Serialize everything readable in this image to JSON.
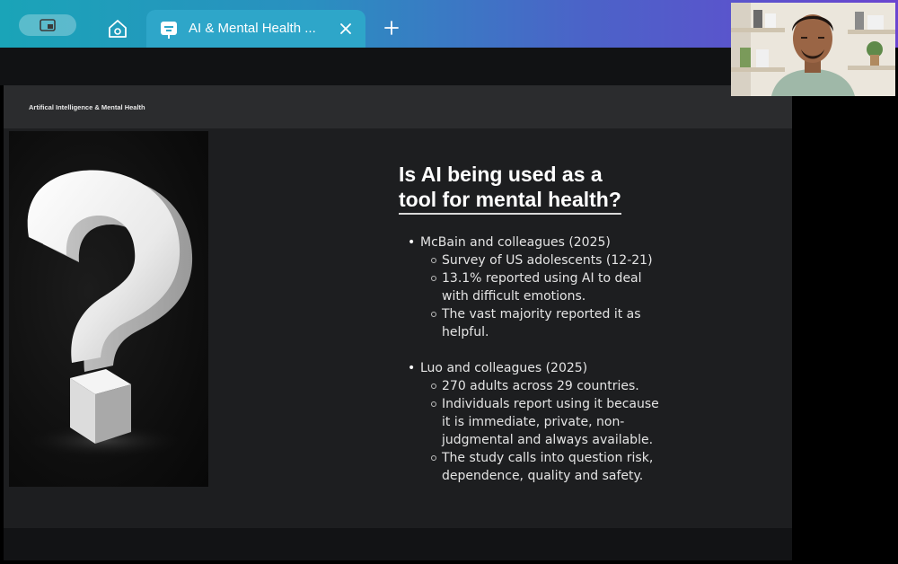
{
  "browser": {
    "tabs": [
      {
        "title": "AI & Mental Health ...",
        "active": true
      }
    ],
    "accent_start": "#1aa4b8",
    "accent_end": "#6a45d0",
    "icons": [
      "window-icon",
      "home-icon",
      "presentation-icon",
      "close-icon",
      "plus-icon"
    ]
  },
  "slide": {
    "header": "Artifical Intelligence & Mental Health",
    "title_line1": "Is AI being used as a",
    "title_line2": "tool for mental health?",
    "image": "white-question-mark",
    "studies": [
      {
        "heading": "McBain and colleagues (2025)",
        "points": [
          [
            "Survey of US adolescents (12-21)"
          ],
          [
            "13.1% reported using AI to deal",
            "with difficult emotions."
          ],
          [
            "The vast majority reported it as",
            "helpful."
          ]
        ]
      },
      {
        "heading": "Luo and colleagues (2025)",
        "points": [
          [
            "270 adults across 29 countries."
          ],
          [
            "Individuals report using it because",
            "it is immediate, private, non-",
            "judgmental and always available."
          ],
          [
            "The study calls into question risk,",
            "dependence, quality and safety."
          ]
        ]
      }
    ]
  },
  "webcam": {
    "subject": "presenter-video"
  }
}
